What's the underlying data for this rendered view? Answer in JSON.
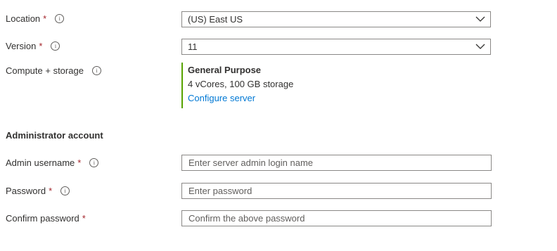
{
  "fields": {
    "location": {
      "label": "Location",
      "required_mark": "*",
      "value": "(US) East US",
      "info_icon": "info-icon"
    },
    "version": {
      "label": "Version",
      "required_mark": "*",
      "value": "11",
      "info_icon": "info-icon"
    },
    "compute": {
      "label": "Compute + storage",
      "info_icon": "info-icon",
      "tier": "General Purpose",
      "spec": "4 vCores, 100 GB storage",
      "link": "Configure server",
      "accent_color": "#57a300"
    }
  },
  "admin_section": {
    "title": "Administrator account",
    "username": {
      "label": "Admin username",
      "required_mark": "*",
      "placeholder": "Enter server admin login name"
    },
    "password": {
      "label": "Password",
      "required_mark": "*",
      "placeholder": "Enter password"
    },
    "confirm": {
      "label": "Confirm password",
      "required_mark": "*",
      "placeholder": "Confirm the above password"
    }
  },
  "colors": {
    "required": "#a4262c",
    "link": "#0078d4",
    "border": "#8a8886"
  }
}
